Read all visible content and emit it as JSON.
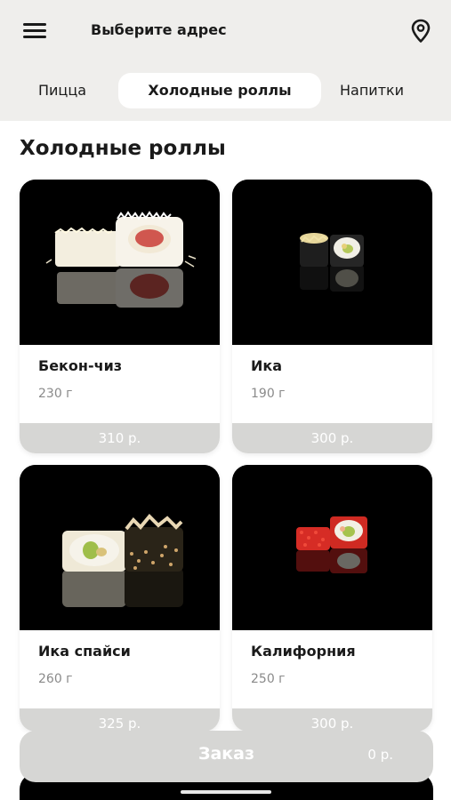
{
  "header": {
    "menu_icon": "hamburger-menu-icon",
    "address_label": "Выберите адрес",
    "location_icon": "location-pin-icon"
  },
  "tabs": [
    {
      "label": "Пицца",
      "active": false
    },
    {
      "label": "Холодные роллы",
      "active": true
    },
    {
      "label": "Напитки",
      "active": false
    }
  ],
  "section": {
    "title": "Холодные роллы"
  },
  "products": [
    {
      "name": "Бекон-чиз",
      "weight": "230 г",
      "price": "310 р."
    },
    {
      "name": "Ика",
      "weight": "190 г",
      "price": "300 р."
    },
    {
      "name": "Ика спайси",
      "weight": "260 г",
      "price": "325 р."
    },
    {
      "name": "Калифорния",
      "weight": "250 г",
      "price": "300 р."
    }
  ],
  "order": {
    "label": "Заказ",
    "total": "0 р."
  },
  "colors": {
    "header_bg": "#efeeec",
    "price_bar": "#d6d6d4",
    "photo_bg": "#000000",
    "text": "#1a1a1a",
    "muted": "#8a8a8a"
  }
}
